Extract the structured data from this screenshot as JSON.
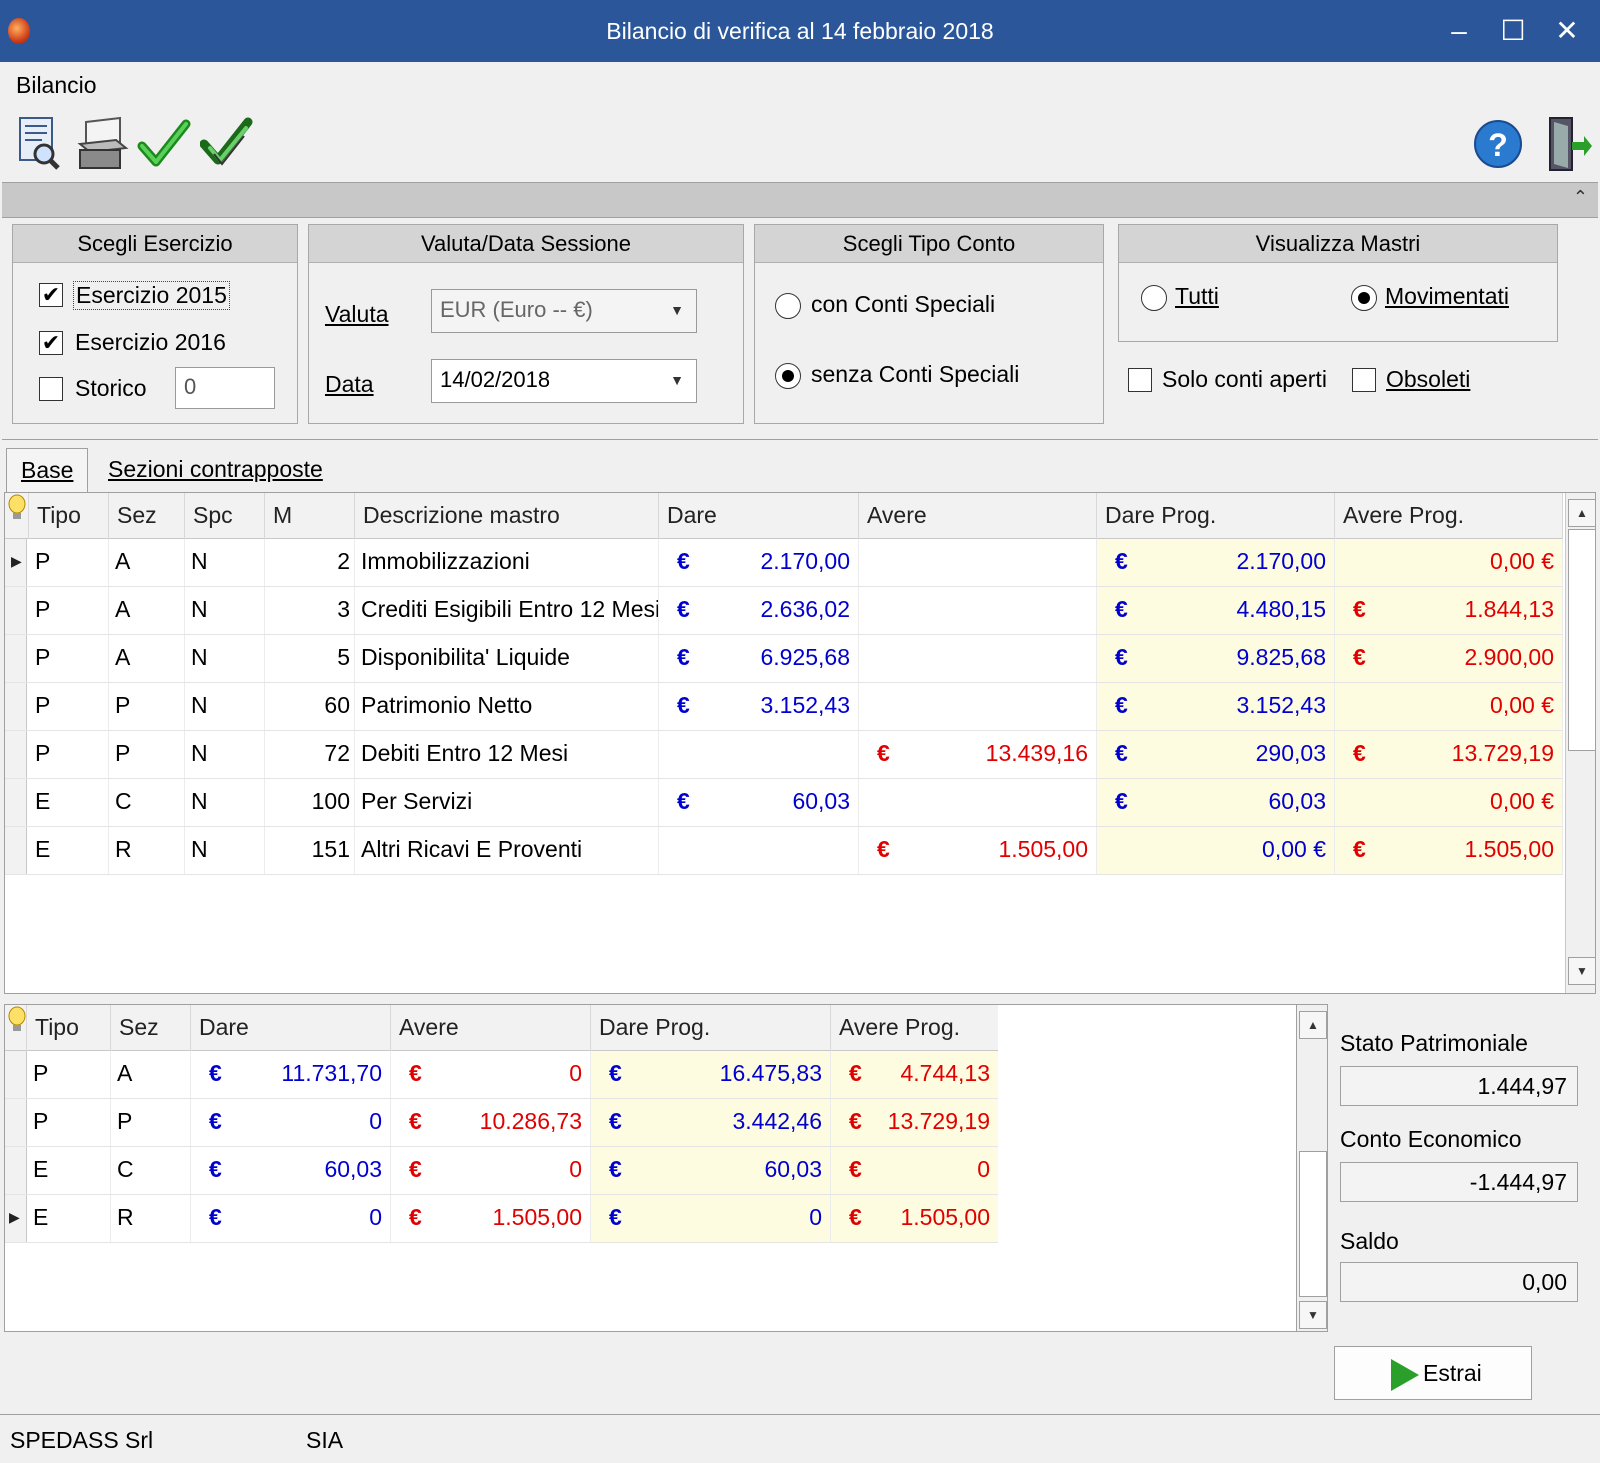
{
  "window": {
    "title": "Bilancio di verifica al 14  febbraio  2018",
    "minimize": "–",
    "maximize": "☐",
    "close": "✕"
  },
  "menu": {
    "bilancio": "Bilancio"
  },
  "toolbar": {
    "items": [
      "preview-icon",
      "print-icon",
      "confirm-icon",
      "confirm-all-icon",
      "help-icon",
      "exit-icon"
    ],
    "collapse": "⌃"
  },
  "esercizio": {
    "title": "Scegli Esercizio",
    "es2015": "Esercizio 2015",
    "es2016": "Esercizio 2016",
    "storico": "Storico",
    "storico_value": "0"
  },
  "sessione": {
    "title": "Valuta/Data Sessione",
    "valuta_label": "Valuta",
    "valuta_value": "EUR (Euro -- €)",
    "data_label": "Data",
    "data_value": "14/02/2018"
  },
  "tipo_conto": {
    "title": "Scegli Tipo Conto",
    "con": "con Conti Speciali",
    "senza": "senza Conti Speciali"
  },
  "mastri": {
    "title": "Visualizza Mastri",
    "tutti": "Tutti",
    "movimentati": "Movimentati",
    "solo_aperti": "Solo conti aperti",
    "obsoleti": "Obsoleti"
  },
  "tabs": {
    "base": "Base",
    "sezioni": "Sezioni contrapposte"
  },
  "grid1": {
    "headers": {
      "tipo": "Tipo",
      "sez": "Sez",
      "spc": "Spc",
      "m": "M",
      "desc": "Descrizione mastro",
      "dare": "Dare",
      "avere": "Avere",
      "dare_prog": "Dare Prog.",
      "avere_prog": "Avere Prog."
    },
    "euro": "€",
    "rows": [
      {
        "tipo": "P",
        "sez": "A",
        "spc": "N",
        "m": "2",
        "desc": "Immobilizzazioni",
        "dare": "2.170,00",
        "avere": "",
        "dare_prog": "2.170,00",
        "avere_prog": "0,00 €"
      },
      {
        "tipo": "P",
        "sez": "A",
        "spc": "N",
        "m": "3",
        "desc": "Crediti Esigibili Entro 12 Mesi",
        "dare": "2.636,02",
        "avere": "",
        "dare_prog": "4.480,15",
        "avere_prog": "1.844,13"
      },
      {
        "tipo": "P",
        "sez": "A",
        "spc": "N",
        "m": "5",
        "desc": "Disponibilita' Liquide",
        "dare": "6.925,68",
        "avere": "",
        "dare_prog": "9.825,68",
        "avere_prog": "2.900,00"
      },
      {
        "tipo": "P",
        "sez": "P",
        "spc": "N",
        "m": "60",
        "desc": "Patrimonio Netto",
        "dare": "3.152,43",
        "avere": "",
        "dare_prog": "3.152,43",
        "avere_prog": "0,00 €"
      },
      {
        "tipo": "P",
        "sez": "P",
        "spc": "N",
        "m": "72",
        "desc": "Debiti Entro 12 Mesi",
        "dare": "",
        "avere": "13.439,16",
        "dare_prog": "290,03",
        "avere_prog": "13.729,19"
      },
      {
        "tipo": "E",
        "sez": "C",
        "spc": "N",
        "m": "100",
        "desc": "Per Servizi",
        "dare": "60,03",
        "avere": "",
        "dare_prog": "60,03",
        "avere_prog": "0,00 €"
      },
      {
        "tipo": "E",
        "sez": "R",
        "spc": "N",
        "m": "151",
        "desc": "Altri Ricavi E Proventi",
        "dare": "",
        "avere": "1.505,00",
        "dare_prog": "0,00 €",
        "avere_prog": "1.505,00"
      }
    ]
  },
  "grid2": {
    "headers": {
      "tipo": "Tipo",
      "sez": "Sez",
      "dare": "Dare",
      "avere": "Avere",
      "dare_prog": "Dare Prog.",
      "avere_prog": "Avere Prog."
    },
    "rows": [
      {
        "tipo": "P",
        "sez": "A",
        "dare": "11.731,70",
        "avere": "0",
        "dare_prog": "16.475,83",
        "avere_prog": "4.744,13"
      },
      {
        "tipo": "P",
        "sez": "P",
        "dare": "0",
        "avere": "10.286,73",
        "dare_prog": "3.442,46",
        "avere_prog": "13.729,19"
      },
      {
        "tipo": "E",
        "sez": "C",
        "dare": "60,03",
        "avere": "0",
        "dare_prog": "60,03",
        "avere_prog": "0"
      },
      {
        "tipo": "E",
        "sez": "R",
        "dare": "0",
        "avere": "1.505,00",
        "dare_prog": "0",
        "avere_prog": "1.505,00"
      }
    ]
  },
  "summary": {
    "stato_label": "Stato Patrimoniale",
    "stato_value": "1.444,97",
    "conto_label": "Conto Economico",
    "conto_value": "-1.444,97",
    "saldo_label": "Saldo",
    "saldo_value": "0,00"
  },
  "estrai": "Estrai",
  "status": {
    "company": "SPEDASS Srl",
    "user": "SIA"
  },
  "colors": {
    "titlebar": "#2b579a",
    "dare": "#0000d0",
    "avere": "#e00000",
    "progressive_bg": "#fdfbe0"
  }
}
